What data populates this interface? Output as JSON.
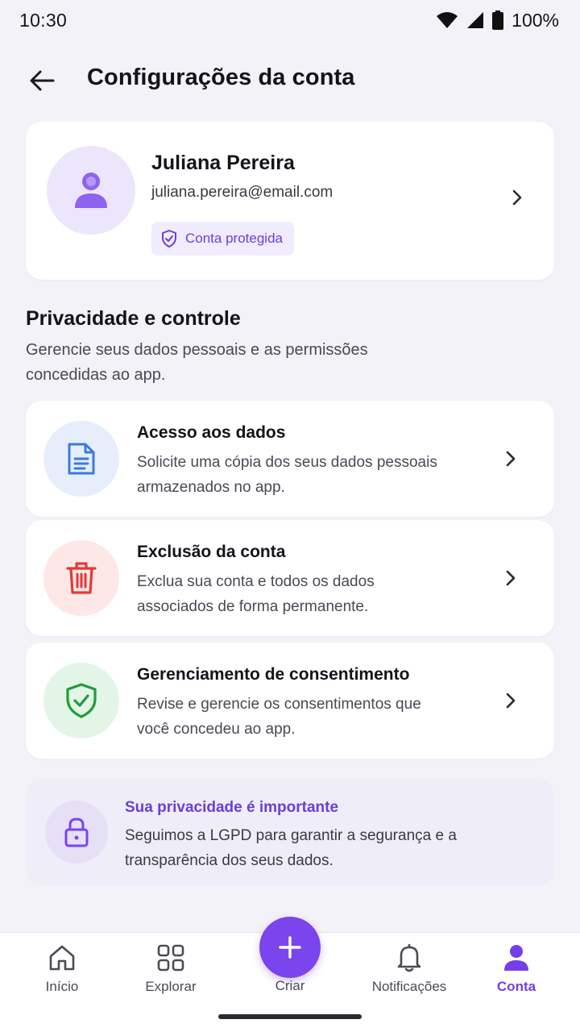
{
  "status_bar": {
    "time": "10:30",
    "battery": "100%"
  },
  "header": {
    "title": "Configurações da conta"
  },
  "profile": {
    "name": "Juliana Pereira",
    "email": "juliana.pereira@email.com",
    "badge": "Conta protegida"
  },
  "privacy": {
    "title": "Privacidade e controle",
    "description": "Gerencie seus dados pessoais e as permissões concedidas ao app.",
    "options": [
      {
        "title": "Acesso aos dados",
        "description": "Solicite uma cópia dos seus dados pessoais armazenados no app.",
        "icon": "document-icon",
        "color": "#3a7be0"
      },
      {
        "title": "Exclusão da conta",
        "description": "Exclua sua conta e todos os dados associados de forma permanente.",
        "icon": "trash-icon",
        "color": "#e53935"
      },
      {
        "title": "Gerenciamento de consentimento",
        "description": "Revise e gerencie os consentimentos que você concedeu ao app.",
        "icon": "shield-check-icon",
        "color": "#1f9d3c"
      }
    ]
  },
  "info": {
    "title": "Sua privacidade é importante",
    "description": "Seguimos a LGPD para garantir a segurança e a transparência dos seus dados."
  },
  "nav": {
    "items": [
      {
        "label": "Início",
        "icon": "home-icon"
      },
      {
        "label": "Explorar",
        "icon": "grid-icon"
      },
      {
        "label": "Criar",
        "icon": "plus-icon"
      },
      {
        "label": "Notificações",
        "icon": "bell-icon"
      },
      {
        "label": "Conta",
        "icon": "person-icon",
        "active": true
      }
    ]
  },
  "colors": {
    "accent": "#7a45ec",
    "background": "#f3f2f9"
  }
}
